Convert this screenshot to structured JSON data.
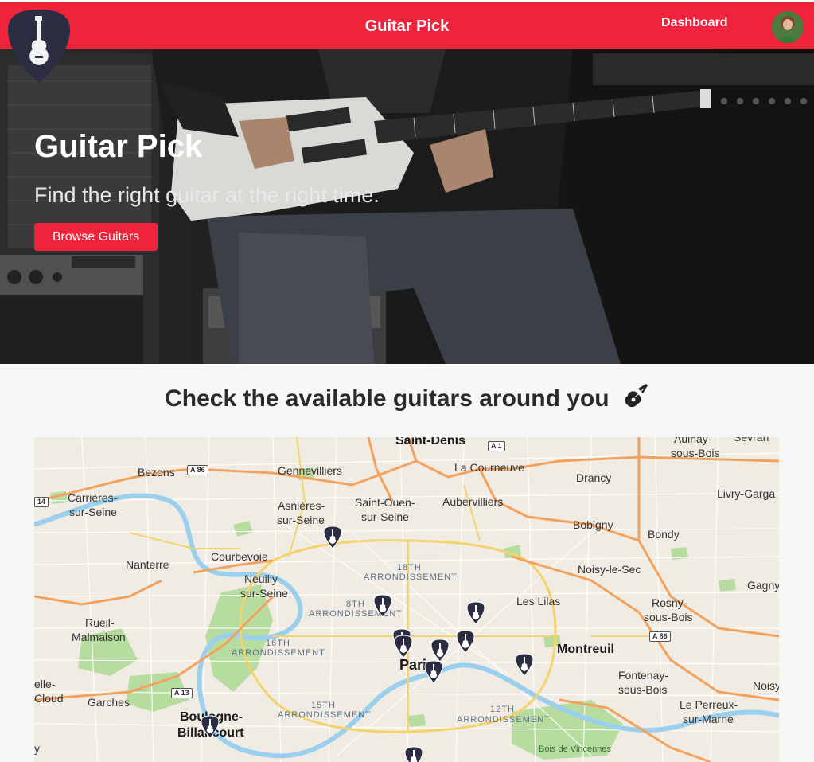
{
  "navbar": {
    "brand_title": "Guitar Pick",
    "dashboard_link": "Dashboard",
    "color": "#ef233c"
  },
  "hero": {
    "title": "Guitar Pick",
    "subtitle": "Find the right guitar at the right time.",
    "button_label": "Browse Guitars"
  },
  "section": {
    "title": "Check the available guitars around you",
    "title_icon": "guitar-emoji"
  },
  "map": {
    "places": {
      "saint_denis": "Saint-Denis",
      "la_courneuve": "La Courneuve",
      "aulnay": "Aulnay-",
      "sous_bois": "sous-Bois",
      "sevran": "Sevran",
      "bezons": "Bezons",
      "gennevilliers": "Gennevilliers",
      "drancy": "Drancy",
      "carrieres": "Carrières-",
      "sur_seine": "sur-Seine",
      "asnieres": "Asnières-",
      "asnieres_2": "sur-Seine",
      "saint_ouen": "Saint-Ouen-",
      "saint_ouen_2": "sur-Seine",
      "aubervilliers": "Aubervilliers",
      "livry": "Livry-Garga",
      "bobigny": "Bobigny",
      "bondy": "Bondy",
      "courbevoie": "Courbevoie",
      "nanterre": "Nanterre",
      "neuilly": "Neuilly-",
      "neuilly_2": "sur-Seine",
      "noisy_le_sec": "Noisy-le-Sec",
      "gagny": "Gagny",
      "les_lilas": "Les Lilas",
      "rosny": "Rosny-",
      "rosny_2": "sous-Bois",
      "rueil": "Rueil-",
      "rueil_2": "Malmaison",
      "montreuil": "Montreuil",
      "paris": "Paris",
      "fontenay": "Fontenay-",
      "fontenay_2": "sous-Bois",
      "noisy": "Noisy",
      "elle": "elle-",
      "cloud": "Cloud",
      "garches": "Garches",
      "boulogne": "Boulogne-",
      "billancourt": "Billancourt",
      "le_perreux": "Le Perreux-",
      "sur_marne": "sur-Marne",
      "y": "y",
      "bois_vincennes": "Bois de Vincennes"
    },
    "arrondissements": {
      "a18": "18TH",
      "a18b": "ARRONDISSEMENT",
      "a8": "8TH",
      "a8b": "ARRONDISSEMENT",
      "a16": "16TH",
      "a16b": "ARRONDISSEMENT",
      "a15": "15TH",
      "a15b": "ARRONDISSEMENT",
      "a12": "12TH",
      "a12b": "ARRONDISSEMENT"
    },
    "roads": {
      "a1": "A 1",
      "a86_w": "A 86",
      "a86_e": "A 86",
      "a13": "A 13",
      "n14": "14"
    },
    "marker_count": 12,
    "marker_color": "#2b2d42"
  }
}
